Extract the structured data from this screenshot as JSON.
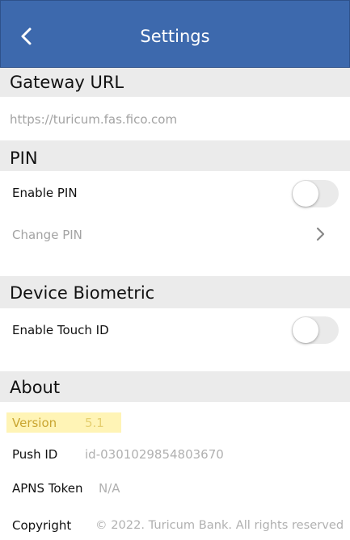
{
  "navbar": {
    "title": "Settings",
    "background": "#3d69ad",
    "back_icon": "chevron-left-icon"
  },
  "gateway": {
    "header": "Gateway URL",
    "url": "https://turicum.fas.fico.com"
  },
  "pin": {
    "header": "PIN",
    "enable_label": "Enable PIN",
    "enable_on": false,
    "change_label": "Change PIN",
    "change_icon": "chevron-right-icon"
  },
  "biometric": {
    "header": "Device Biometric",
    "enable_label": "Enable Touch ID",
    "enable_on": false
  },
  "about": {
    "header": "About",
    "version_label": "Version",
    "version_value": "5.1",
    "push_label": "Push ID",
    "push_value": "id-0301029854803670",
    "apns_label": "APNS Token",
    "apns_value": "N/A",
    "copyright_label": "Copyright",
    "copyright_value": "© 2022. Turicum Bank. All rights reserved",
    "highlight_color": "#fff4b6"
  }
}
